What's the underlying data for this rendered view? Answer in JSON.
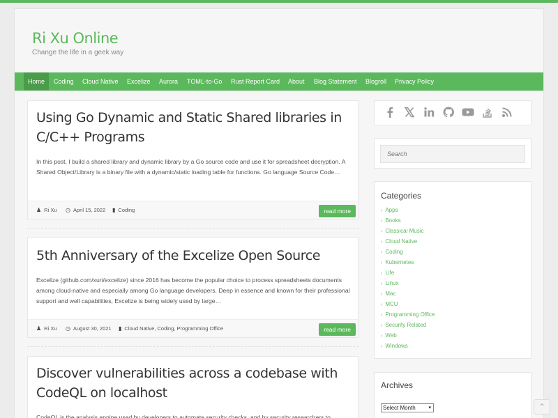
{
  "site": {
    "title": "Ri Xu Online",
    "description": "Change the life in a geek way"
  },
  "nav": [
    "Home",
    "Coding",
    "Cloud Native",
    "Excelize",
    "Aurora",
    "TOML-to-Go",
    "Rust Report Card",
    "About",
    "Blog Statement",
    "Blogroll",
    "Privacy Policy"
  ],
  "posts": [
    {
      "title": "Using Go Dynamic and Static Shared libraries in C/C++ Programs",
      "excerpt": "In this post, I build a shared library and dynamic library by a Go source code and use it for spreadsheet decryption. A Shared Object/Library is a binary file with a dynamic/static loading table for functions. Go language Source Code…",
      "author": "Ri Xu",
      "date": "April 15, 2022",
      "categories": "Coding",
      "read_more": "read more"
    },
    {
      "title": "5th Anniversary of the Excelize Open Source",
      "excerpt": "Excelize (github.com/xuri/excelize) since 2016 has become the popular choice to process spreadsheets documents among cloud-native and especially among Go language developers. Deep in essence and known for their professional support and well capabilities, Excelize is being widely used by large…",
      "author": "Ri Xu",
      "date": "August 30, 2021",
      "categories": "Cloud Native, Coding, Programming Office",
      "read_more": "read more"
    },
    {
      "title": "Discover vulnerabilities across a codebase with CodeQL on localhost",
      "excerpt": "CodeQL is the analysis engine used by developers to automate security checks, and by security researchers to"
    }
  ],
  "social_icons": [
    "facebook-icon",
    "x-twitter-icon",
    "linkedin-icon",
    "github-icon",
    "youtube-icon",
    "stackoverflow-icon",
    "rss-icon"
  ],
  "search": {
    "placeholder": "Search"
  },
  "categories": {
    "title": "Categories",
    "items": [
      "Apps",
      "Books",
      "Classical Music",
      "Cloud Native",
      "Coding",
      "Kubernetes",
      "Life",
      "Linux",
      "Mac",
      "MCU",
      "Programming Office",
      "Security Related",
      "Web",
      "Windows"
    ]
  },
  "archives": {
    "title": "Archives",
    "selected": "Select Month"
  },
  "colors": {
    "accent": "#5cb85c",
    "nav_active": "#4a9b4a"
  }
}
